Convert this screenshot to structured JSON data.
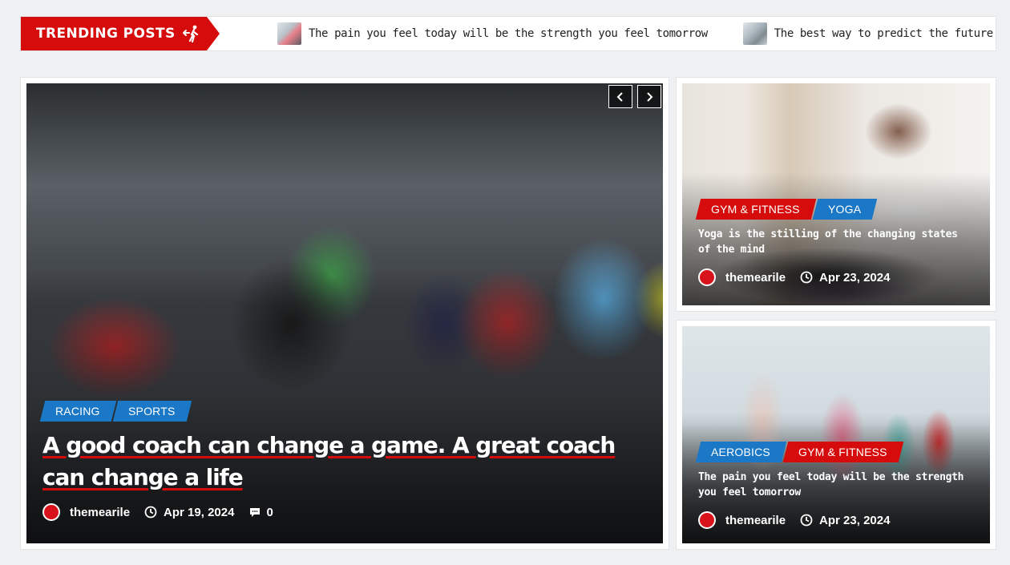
{
  "trending": {
    "label": "TRENDING POSTS",
    "items": [
      {
        "title": "The pain you feel today will be the strength you feel tomorrow"
      },
      {
        "title": "The best way to predict the future is to create it"
      }
    ]
  },
  "featured": {
    "tags": [
      {
        "label": "RACING",
        "color": "#1b78c6"
      },
      {
        "label": "SPORTS",
        "color": "#1b78c6"
      }
    ],
    "title": "A good coach can change a game. A great coach can change a life",
    "author": "themearile",
    "date": "Apr 19, 2024",
    "comments": "0"
  },
  "side_posts": [
    {
      "tags": [
        {
          "label": "GYM & FITNESS",
          "color": "#d60b0b"
        },
        {
          "label": "YOGA",
          "color": "#1b78c6"
        }
      ],
      "title": "Yoga is the stilling of the changing states of the mind",
      "author": "themearile",
      "date": "Apr 23, 2024"
    },
    {
      "tags": [
        {
          "label": "AEROBICS",
          "color": "#1b78c6"
        },
        {
          "label": "GYM & FITNESS",
          "color": "#d60b0b"
        }
      ],
      "title": "The pain you feel today will be the strength you feel tomorrow",
      "author": "themearile",
      "date": "Apr 23, 2024"
    }
  ],
  "icons": {
    "trending": "walking-person-icon",
    "prev": "chevron-left-icon",
    "next": "chevron-right-icon",
    "date": "clock-icon",
    "comments": "comment-icon",
    "author": "avatar"
  },
  "colors": {
    "accent_red": "#d60b0b",
    "accent_blue": "#1b78c6",
    "background": "#eef0f2"
  }
}
